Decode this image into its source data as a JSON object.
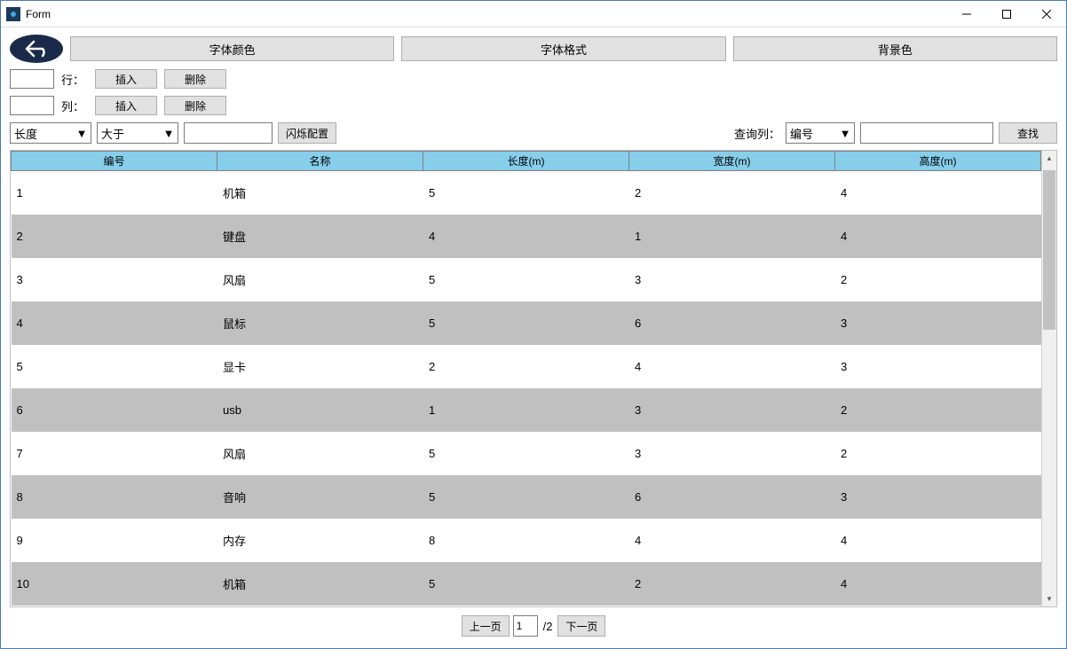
{
  "window": {
    "title": "Form"
  },
  "top_buttons": {
    "font_color": "字体颜色",
    "font_format": "字体格式",
    "bg_color": "背景色"
  },
  "row_ctrl": {
    "label": "行：",
    "insert": "插入",
    "delete": "删除"
  },
  "col_ctrl": {
    "label": "列：",
    "insert": "插入",
    "delete": "删除"
  },
  "filter": {
    "field": "长度",
    "op": "大于",
    "value": "",
    "blink_btn": "闪烁配置",
    "query_label": "查询列：",
    "query_field": "编号",
    "query_value": "",
    "find_btn": "查找"
  },
  "table": {
    "headers": [
      "编号",
      "名称",
      "长度(m)",
      "宽度(m)",
      "高度(m)"
    ],
    "rows": [
      [
        "1",
        "机箱",
        "5",
        "2",
        "4"
      ],
      [
        "2",
        "键盘",
        "4",
        "1",
        "4"
      ],
      [
        "3",
        "风扇",
        "5",
        "3",
        "2"
      ],
      [
        "4",
        "鼠标",
        "5",
        "6",
        "3"
      ],
      [
        "5",
        "显卡",
        "2",
        "4",
        "3"
      ],
      [
        "6",
        "usb",
        "1",
        "3",
        "2"
      ],
      [
        "7",
        "风扇",
        "5",
        "3",
        "2"
      ],
      [
        "8",
        "音响",
        "5",
        "6",
        "3"
      ],
      [
        "9",
        "内存",
        "8",
        "4",
        "4"
      ],
      [
        "10",
        "机箱",
        "5",
        "2",
        "4"
      ]
    ]
  },
  "pager": {
    "prev": "上一页",
    "page": "1",
    "total": "/2",
    "next": "下一页"
  }
}
